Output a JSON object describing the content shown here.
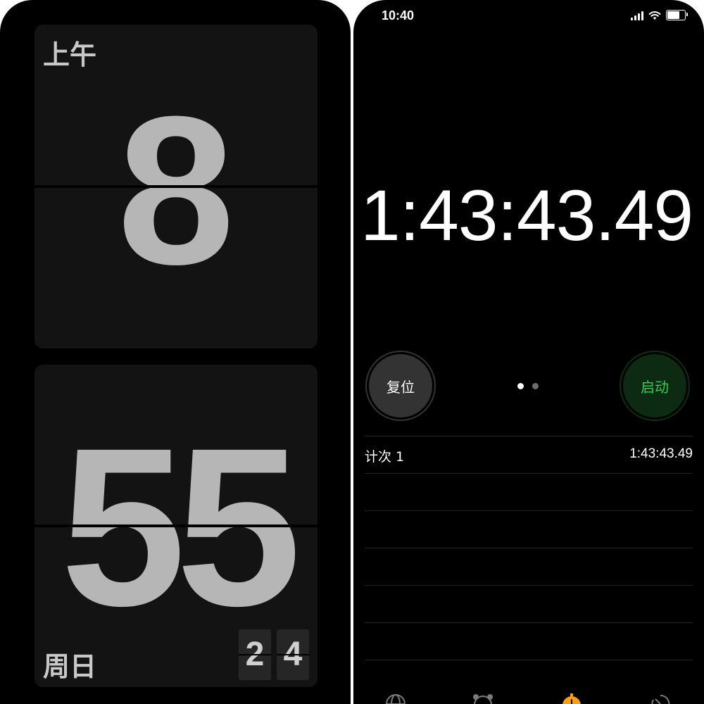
{
  "flip_clock": {
    "ampm": "上午",
    "hour": "8",
    "minute": "55",
    "weekday": "周日",
    "date_tens": "2",
    "date_ones": "4"
  },
  "stopwatch": {
    "status_time": "10:40",
    "elapsed": "1:43:43.49",
    "reset_label": "复位",
    "start_label": "启动",
    "laps": [
      {
        "label": "计次 1",
        "time": "1:43:43.49"
      }
    ]
  },
  "tab_bar": {
    "icons": [
      "globe-icon",
      "alarm-icon",
      "stopwatch-icon",
      "timer-icon"
    ],
    "active_color": "#ff9f0a"
  },
  "colors": {
    "start_green": "#30d158",
    "reset_gray": "#333333"
  }
}
